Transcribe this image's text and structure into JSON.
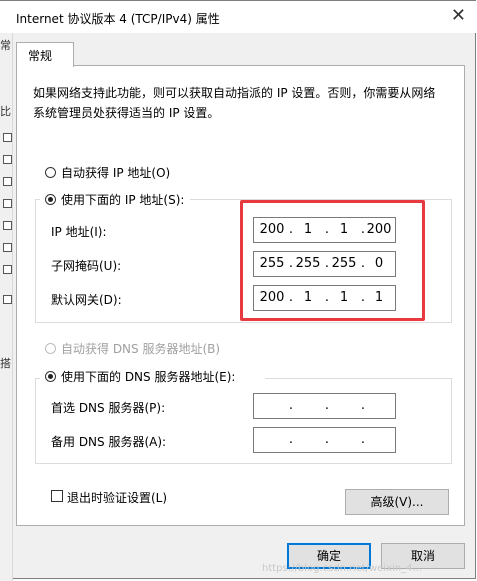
{
  "window": {
    "title": "Internet 协议版本 4 (TCP/IPv4) 属性"
  },
  "behind": {
    "chars": [
      "常",
      "比",
      "搭"
    ]
  },
  "tab": {
    "label": "常规"
  },
  "description": "如果网络支持此功能，则可以获取自动指派的 IP 设置。否则，你需要从网络系统管理员处获得适当的 IP 设置。",
  "ip": {
    "auto_label": "自动获得 IP 地址(O)",
    "manual_label": "使用下面的 IP 地址(S):",
    "selected": "manual",
    "address_label": "IP 地址(I):",
    "address": [
      "200",
      "1",
      "1",
      "200"
    ],
    "subnet_label": "子网掩码(U):",
    "subnet": [
      "255",
      "255",
      "255",
      "0"
    ],
    "gateway_label": "默认网关(D):",
    "gateway": [
      "200",
      "1",
      "1",
      "1"
    ]
  },
  "dns": {
    "auto_label": "自动获得 DNS 服务器地址(B)",
    "manual_label": "使用下面的 DNS 服务器地址(E):",
    "selected": "manual",
    "preferred_label": "首选 DNS 服务器(P):",
    "preferred": [
      "",
      "",
      "",
      ""
    ],
    "alternate_label": "备用 DNS 服务器(A):",
    "alternate": [
      "",
      "",
      "",
      ""
    ]
  },
  "validate": {
    "label": "退出时验证设置(L)",
    "checked": false
  },
  "buttons": {
    "advanced": "高级(V)...",
    "ok": "确定",
    "cancel": "取消"
  },
  "watermark": "https://blog.csdn.net/weixin_4..."
}
